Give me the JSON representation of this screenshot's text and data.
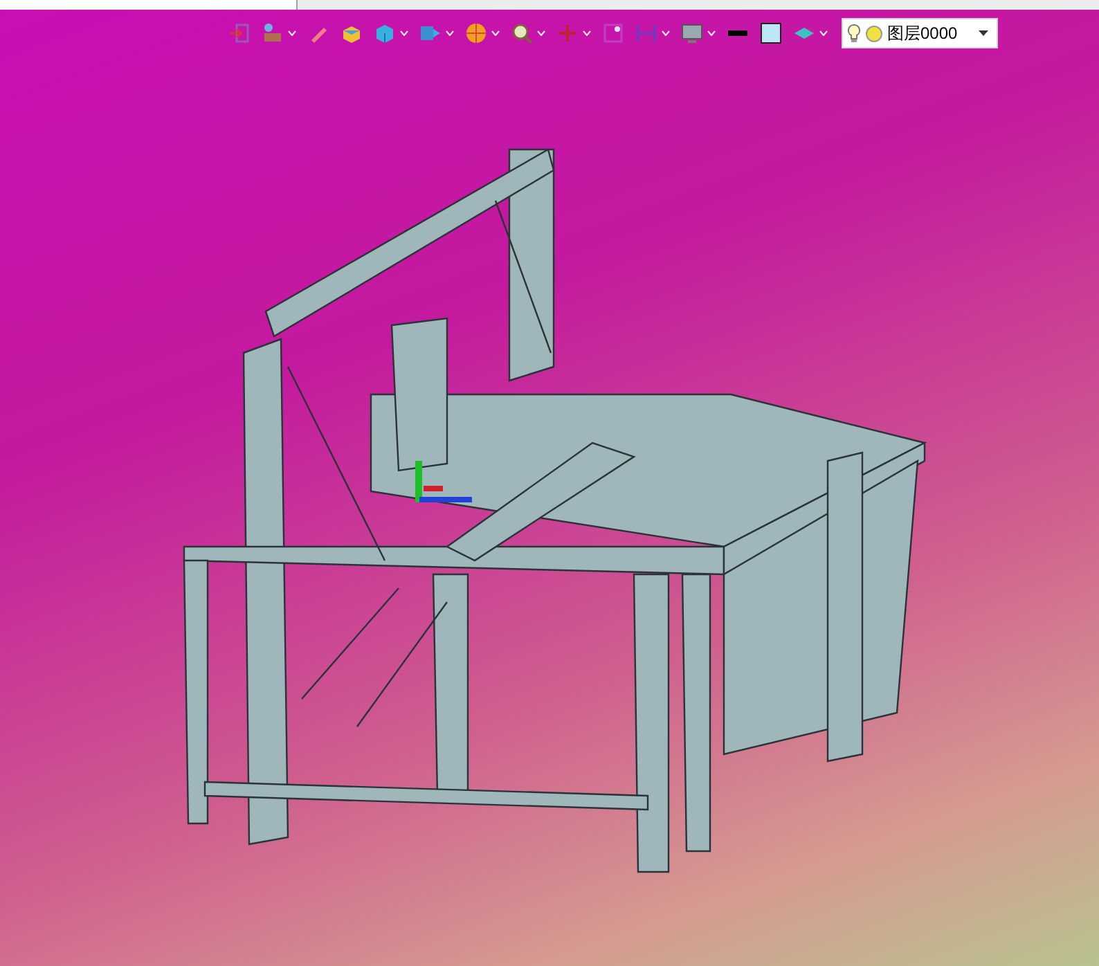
{
  "toolbar": {
    "tools": [
      {
        "kind": "exit",
        "has_dropdown": false
      },
      {
        "kind": "layers",
        "has_dropdown": true
      },
      {
        "kind": "pencil",
        "has_dropdown": false
      },
      {
        "kind": "box",
        "has_dropdown": false
      },
      {
        "kind": "cube",
        "has_dropdown": true
      },
      {
        "kind": "view",
        "has_dropdown": true
      },
      {
        "kind": "wheel",
        "has_dropdown": true
      },
      {
        "kind": "zoom",
        "has_dropdown": true
      },
      {
        "kind": "point",
        "has_dropdown": true
      },
      {
        "kind": "select",
        "has_dropdown": false
      },
      {
        "kind": "dimension",
        "has_dropdown": true
      },
      {
        "kind": "monitor",
        "has_dropdown": true
      },
      {
        "kind": "line",
        "has_dropdown": false
      },
      {
        "kind": "fill",
        "has_dropdown": false
      },
      {
        "kind": "material",
        "has_dropdown": true
      }
    ],
    "layer_select": {
      "value": "图层0000"
    }
  }
}
